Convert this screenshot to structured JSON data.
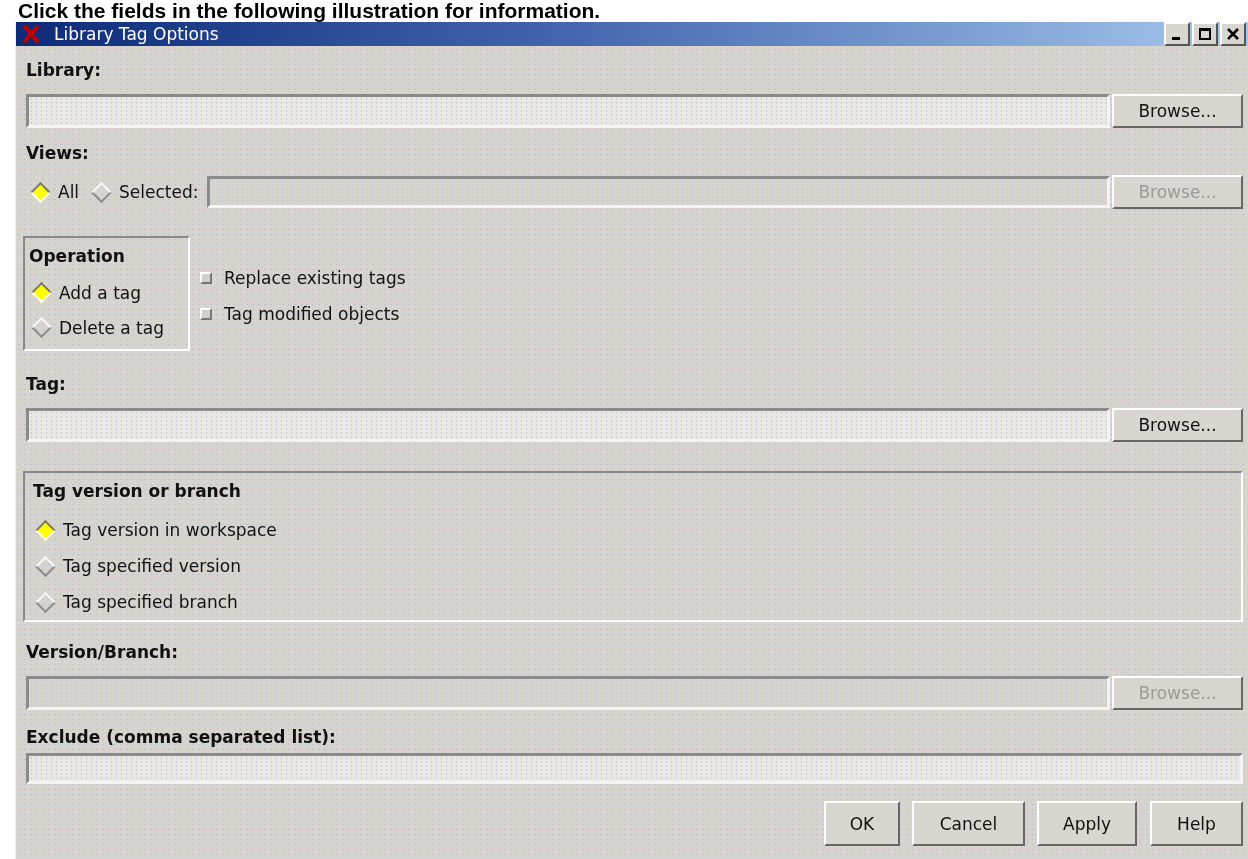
{
  "caption": "Click the fields in the following illustration for information.",
  "window": {
    "title": "Library Tag Options"
  },
  "library": {
    "label": "Library:",
    "field_disabled": false,
    "browse": {
      "label": "Browse...",
      "disabled": false
    }
  },
  "views": {
    "label": "Views:",
    "options": [
      {
        "label": "All",
        "selected": true
      },
      {
        "label": "Selected:",
        "selected": false
      }
    ],
    "field_disabled": true,
    "browse": {
      "label": "Browse...",
      "disabled": true
    }
  },
  "operation": {
    "title": "Operation",
    "options": [
      {
        "label": "Add a tag",
        "selected": true
      },
      {
        "label": "Delete a tag",
        "selected": false
      }
    ]
  },
  "checkboxes": [
    {
      "label": "Replace existing tags",
      "checked": false
    },
    {
      "label": "Tag modified objects",
      "checked": false
    }
  ],
  "tag": {
    "label": "Tag:",
    "field_disabled": false,
    "browse": {
      "label": "Browse...",
      "disabled": false
    }
  },
  "tag_version": {
    "title": "Tag version or branch",
    "options": [
      {
        "label": "Tag version in workspace",
        "selected": true
      },
      {
        "label": "Tag specified version",
        "selected": false
      },
      {
        "label": "Tag specified branch",
        "selected": false
      }
    ]
  },
  "version_branch": {
    "label": "Version/Branch:",
    "field_disabled": true,
    "browse": {
      "label": "Browse...",
      "disabled": true
    }
  },
  "exclude": {
    "label": "Exclude (comma separated list):",
    "field_disabled": false
  },
  "buttons": [
    {
      "label": "OK"
    },
    {
      "label": "Cancel"
    },
    {
      "label": "Apply"
    },
    {
      "label": "Help"
    }
  ]
}
